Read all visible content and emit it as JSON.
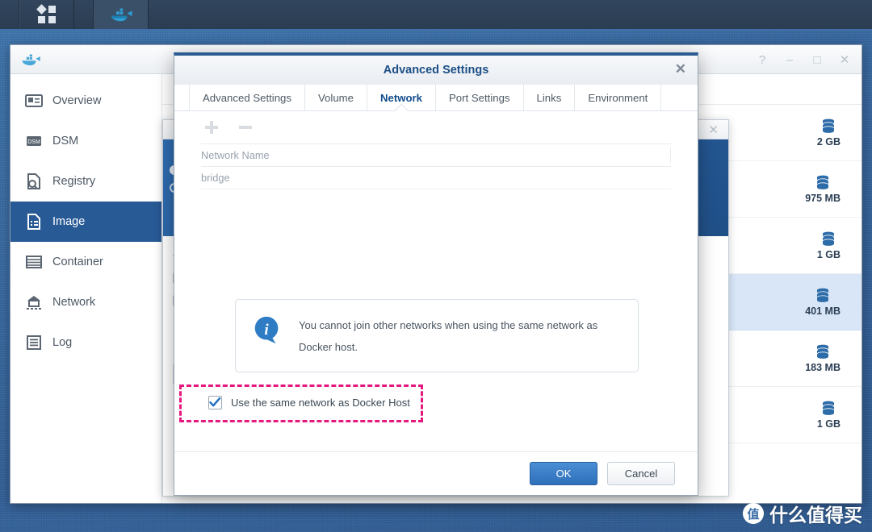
{
  "taskbar": {
    "items": [
      {
        "name": "dsm-menu",
        "icon": "grid-squares-icon"
      },
      {
        "name": "docker-app",
        "icon": "docker-whale-icon"
      }
    ]
  },
  "window": {
    "app_icon": "docker-whale-icon",
    "controls": [
      {
        "name": "help",
        "glyph": "?"
      },
      {
        "name": "minimize",
        "glyph": "–"
      },
      {
        "name": "maximize",
        "glyph": "□"
      },
      {
        "name": "close",
        "glyph": "✕"
      }
    ]
  },
  "sidebar": {
    "items": [
      {
        "label": "Overview",
        "icon": "overview-card-icon",
        "active": false
      },
      {
        "label": "DSM",
        "icon": "dsm-badge-icon",
        "active": false
      },
      {
        "label": "Registry",
        "icon": "registry-search-icon",
        "active": false
      },
      {
        "label": "Image",
        "icon": "image-file-icon",
        "active": true
      },
      {
        "label": "Container",
        "icon": "container-box-icon",
        "active": false
      },
      {
        "label": "Network",
        "icon": "network-house-icon",
        "active": false
      },
      {
        "label": "Log",
        "icon": "log-list-icon",
        "active": false
      }
    ]
  },
  "image_list": {
    "rows": [
      {
        "size": "2 GB",
        "icon": "database-stack-icon",
        "selected": false
      },
      {
        "size": "975 MB",
        "icon": "database-stack-icon",
        "selected": false
      },
      {
        "size": "1 GB",
        "icon": "database-stack-icon",
        "selected": false
      },
      {
        "size": "401 MB",
        "icon": "database-stack-icon",
        "selected": true
      },
      {
        "size": "183 MB",
        "icon": "database-stack-icon",
        "selected": false
      },
      {
        "size": "1 GB",
        "icon": "database-stack-icon",
        "selected": false
      }
    ]
  },
  "background_dialog": {
    "close_glyph": "✕",
    "partial_label": "C"
  },
  "modal": {
    "title": "Advanced Settings",
    "close_glyph": "✕",
    "tabs": [
      {
        "label": "Advanced Settings",
        "active": false
      },
      {
        "label": "Volume",
        "active": false
      },
      {
        "label": "Network",
        "active": true
      },
      {
        "label": "Port Settings",
        "active": false
      },
      {
        "label": "Links",
        "active": false
      },
      {
        "label": "Environment",
        "active": false
      }
    ],
    "toolbar": {
      "add_icon": "plus-icon",
      "remove_icon": "minus-icon"
    },
    "table": {
      "columns": [
        "Network Name"
      ],
      "rows": [
        {
          "network_name": "bridge"
        }
      ]
    },
    "info": {
      "icon": "info-bubble-icon",
      "text": "You cannot join other networks when using the same network as Docker host."
    },
    "host_checkbox": {
      "label": "Use the same network as Docker Host",
      "checked": true,
      "annotation_color": "#e5187f"
    },
    "footer": {
      "ok_label": "OK",
      "cancel_label": "Cancel"
    }
  },
  "watermark": {
    "badge": "值",
    "text": "什么值得买"
  },
  "colors": {
    "accent_blue": "#285a96",
    "title_blue": "#1d4f86",
    "annotation_pink": "#e5187f",
    "selected_row": "#d8e6f7",
    "desktop": "#3a6ea8"
  }
}
